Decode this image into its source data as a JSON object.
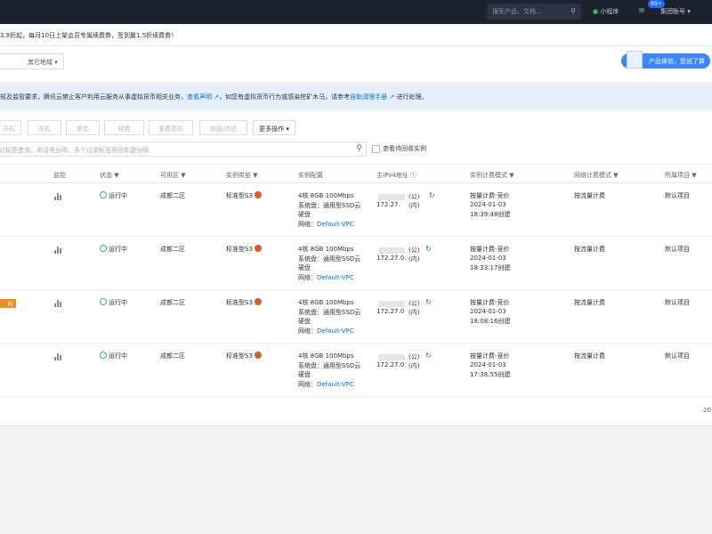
{
  "topbar": {
    "search_placeholder": "搜索产品、文档...",
    "mini_program": "小程序",
    "badge": "99+",
    "account": "集团账号"
  },
  "banner": {
    "text": "3.9折起，每月10日上架会员专属续费券，签到赢1.5折续费券！"
  },
  "region": {
    "label": "其它地域"
  },
  "experience_button": "产品体验，您说了算",
  "notice": {
    "part1": "规及监管要求，腾讯云禁止客户利用云服务从事虚拟货币相关业务，",
    "link1": "查看声明",
    "part2": "，如您有虚拟货币行为或感染挖矿木马，请参考",
    "link2": "自助清理手册",
    "part3": "进行处理。"
  },
  "toolbar": {
    "buttons": [
      "开机",
      "关机",
      "重启",
      "续费",
      "重置密码",
      "销毁/退还"
    ],
    "more": "更多操作"
  },
  "filter": {
    "placeholder": "过标签查询，用逗号分隔，多个过滤标签用回车键分隔",
    "recycle_label": "查看待回收实例"
  },
  "table": {
    "headers": [
      "监控",
      "状态",
      "可用区",
      "实例类型",
      "实例配置",
      "主IPv4地址",
      "实例计费模式",
      "网络计费模式",
      "所属项目"
    ],
    "rows": [
      {
        "status": "运行中",
        "zone": "成都二区",
        "type": "标准型S3",
        "config": "4核 8GB 100Mbps",
        "disk1": "系统盘：通用型SSD云",
        "disk2": "硬盘",
        "net_label": "网络：",
        "vpc": "Default-VPC",
        "ip": "172.27.",
        "ip_pub": "(公)",
        "ip_priv": "(内)",
        "billing": "按量计费-竞价",
        "date": "2024-01-03",
        "time": "18:39:48创建",
        "net_billing": "按流量计费",
        "project": "默认项目"
      },
      {
        "status": "运行中",
        "zone": "成都二区",
        "type": "标准型S3",
        "config": "4核 8GB 100Mbps",
        "disk1": "系统盘：通用型SSD云",
        "disk2": "硬盘",
        "net_label": "网络：",
        "vpc": "Default-VPC",
        "ip": "172.27.0.",
        "ip_pub": "(公)",
        "ip_priv": "(内)",
        "billing": "按量计费-竞价",
        "date": "2024-01-03",
        "time": "18:33:17创建",
        "net_billing": "按流量计费",
        "project": "默认项目"
      },
      {
        "status": "运行中",
        "zone": "成都二区",
        "type": "标准型S3",
        "config": "4核 8GB 100Mbps",
        "disk1": "系统盘：通用型SSD云",
        "disk2": "硬盘",
        "net_label": "网络：",
        "vpc": "Default-VPC",
        "ip": "172.27.0",
        "ip_pub": "(公)",
        "ip_priv": "(内)",
        "billing": "按量计费-竞价",
        "date": "2024-01-03",
        "time": "18:08:16创建",
        "net_billing": "按流量计费",
        "project": "默认项目",
        "tag": "到"
      },
      {
        "status": "运行中",
        "zone": "成都二区",
        "type": "标准型S3",
        "config": "4核 8GB 100Mbps",
        "disk1": "系统盘：通用型SSD云",
        "disk2": "硬盘",
        "net_label": "网络：",
        "vpc": "Default-VPC",
        "ip": "172.27.0",
        "ip_pub": "(公)",
        "ip_priv": "(内)",
        "billing": "按量计费-竞价",
        "date": "2024-01-03",
        "time": "17:38:55创建",
        "net_billing": "按流量计费",
        "project": "默认项目"
      }
    ]
  },
  "pager": "20"
}
